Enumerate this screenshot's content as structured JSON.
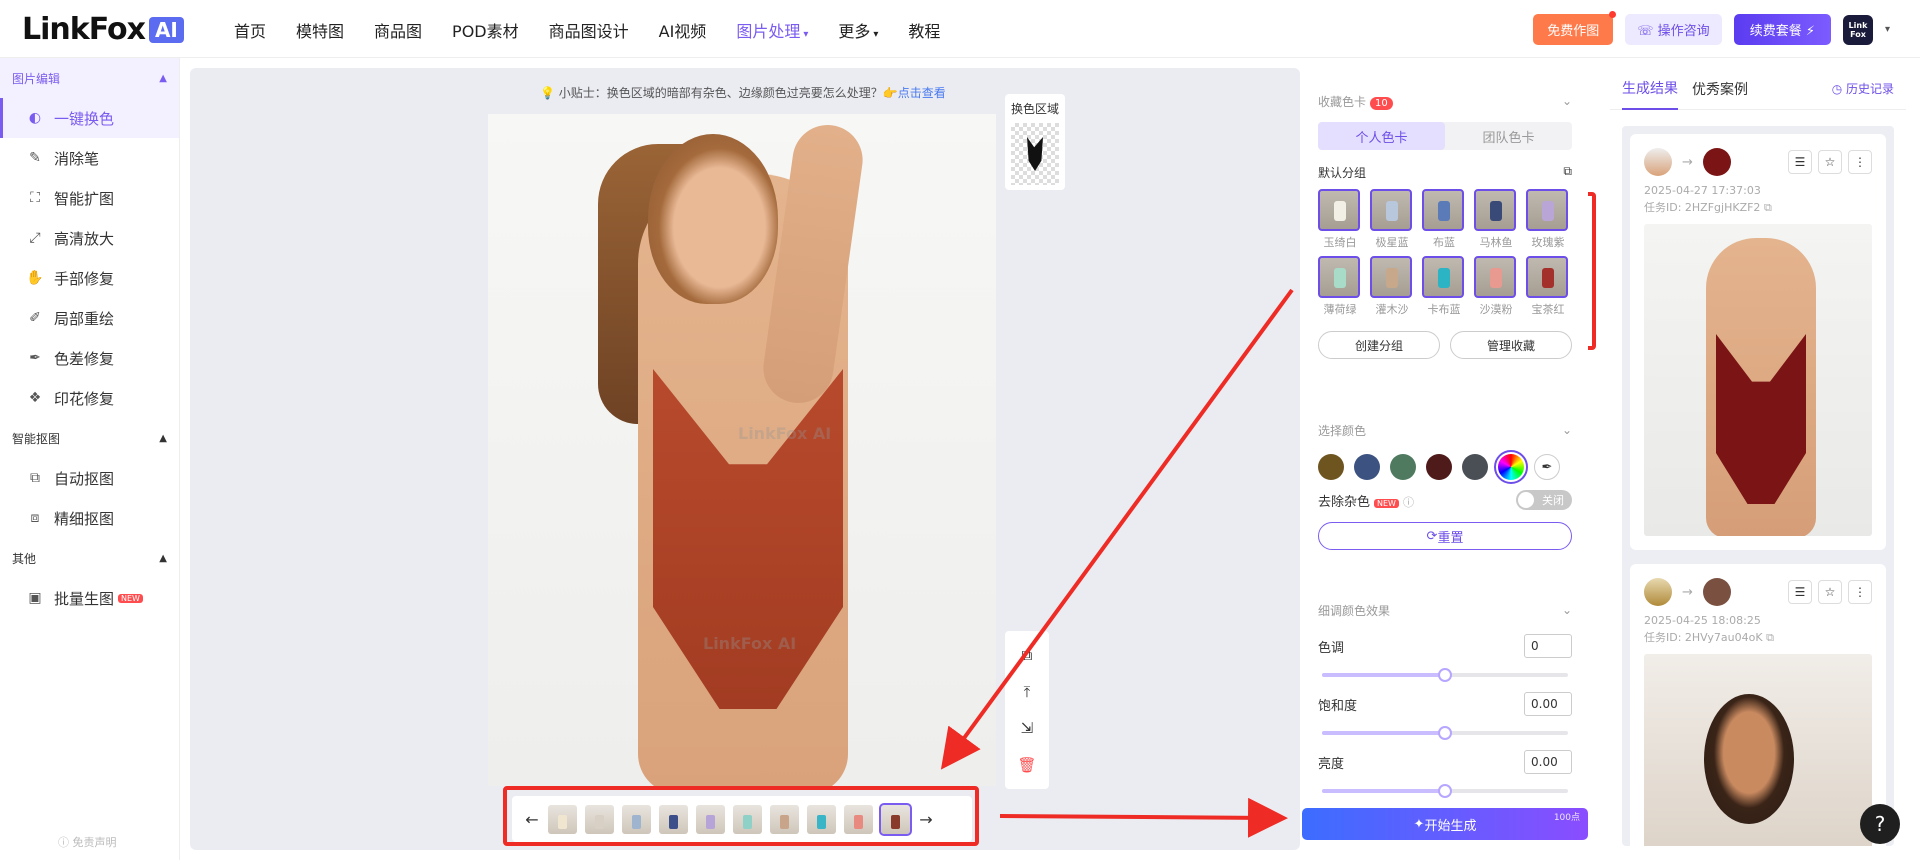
{
  "brand": {
    "name": "LinkFox",
    "ai": "AI"
  },
  "nav": {
    "items": [
      "首页",
      "模特图",
      "商品图",
      "POD素材",
      "商品图设计",
      "AI视频",
      "图片处理",
      "更多",
      "教程"
    ],
    "free_btn": "免费作图",
    "consult_btn": "操作咨询",
    "renew_btn": "续费套餐",
    "avatar_text": "Link Fox"
  },
  "sidebar": {
    "sections": [
      {
        "title": "图片编辑",
        "items": [
          "一键换色",
          "消除笔",
          "智能扩图",
          "高清放大",
          "手部修复",
          "局部重绘",
          "色差修复",
          "印花修复"
        ]
      },
      {
        "title": "智能抠图",
        "items": [
          "自动抠图",
          "精细抠图"
        ]
      },
      {
        "title": "其他",
        "items": [
          "批量生图"
        ]
      }
    ],
    "new_badge": "NEW",
    "disclaimer": "免责声明"
  },
  "canvas": {
    "tip": "💡 小贴士：换色区域的暗部有杂色、边缘颜色过亮要怎么处理？",
    "tip_link": "👉点击查看",
    "swap_area_label": "换色区域",
    "watermark": "LinkFox AI",
    "thumb_colors": [
      "#f0e6d0",
      "#d8d0c4",
      "#9fb4cf",
      "#3d4f8a",
      "#b6a4d8",
      "#8fd1c7",
      "#c8a48a",
      "#3ab5c8",
      "#e88a80",
      "#8a3a2a"
    ]
  },
  "color_panel": {
    "title": "收藏色卡",
    "count": "10",
    "tabs": [
      "个人色卡",
      "团队色卡"
    ],
    "group": "默认分组",
    "swatches": [
      {
        "name": "玉绮白",
        "color": "#f2efe6"
      },
      {
        "name": "极星蓝",
        "color": "#b8c7dc"
      },
      {
        "name": "布蓝",
        "color": "#5b7bb8"
      },
      {
        "name": "马林鱼",
        "color": "#3a4a78"
      },
      {
        "name": "玫瑰紫",
        "color": "#b9a5d6"
      },
      {
        "name": "薄荷绿",
        "color": "#a9dcc8"
      },
      {
        "name": "灌木沙",
        "color": "#c7a88a"
      },
      {
        "name": "卡布蓝",
        "color": "#2cb3c4"
      },
      {
        "name": "沙漠粉",
        "color": "#e89a90"
      },
      {
        "name": "宝茶红",
        "color": "#a3302a"
      }
    ],
    "create_group": "创建分组",
    "manage": "管理收藏"
  },
  "select_color": {
    "title": "选择颜色",
    "colors": [
      "#6e5520",
      "#3c5280",
      "#4f7a60",
      "#4f1a1a",
      "#4a4f55"
    ],
    "remove_noise": "去除杂色",
    "new": "NEW",
    "toggle": "关闭",
    "reset": "重置"
  },
  "adjust": {
    "title": "细调颜色效果",
    "rows": [
      {
        "label": "色调",
        "value": "0",
        "pos": 0.5
      },
      {
        "label": "饱和度",
        "value": "0.00",
        "pos": 0.5
      },
      {
        "label": "亮度",
        "value": "0.00",
        "pos": 0.5
      }
    ]
  },
  "generate": {
    "label": "开始生成",
    "cost": "100点"
  },
  "results": {
    "tabs": [
      "生成结果",
      "优秀案例"
    ],
    "history": "历史记录",
    "cards": [
      {
        "color": "#7b1414",
        "time": "2025-04-27 17:37:03",
        "task": "任务ID: 2HZFgjHKZF2"
      },
      {
        "color": "#7a5040",
        "time": "2025-04-25 18:08:25",
        "task": "任务ID: 2HVy7au04oK"
      }
    ]
  }
}
